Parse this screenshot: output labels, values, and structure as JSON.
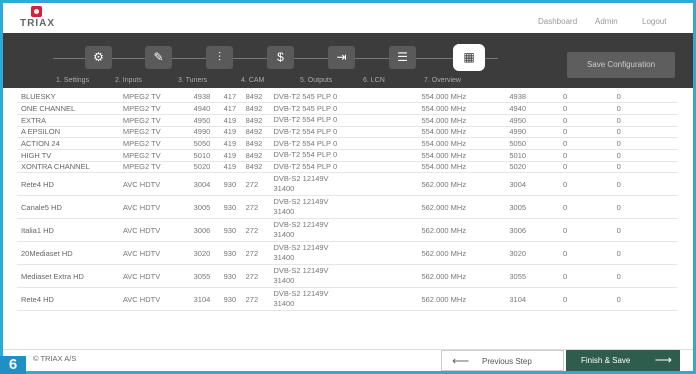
{
  "header": {
    "logo_text": "TRIAX",
    "links": [
      "Dashboard",
      "Admin",
      "Logout"
    ]
  },
  "steps": [
    {
      "label": "1. Settings",
      "icon": "gear-icon",
      "glyph": "⚙"
    },
    {
      "label": "2. Inputs",
      "icon": "plug-icon",
      "glyph": "✎"
    },
    {
      "label": "3. Tuners",
      "icon": "sliders-icon",
      "glyph": "⫶"
    },
    {
      "label": "4. CAM",
      "icon": "cam-card-icon",
      "glyph": "$"
    },
    {
      "label": "5. Outputs",
      "icon": "output-arrow-icon",
      "glyph": "⇥"
    },
    {
      "label": "6. LCN",
      "icon": "list-icon",
      "glyph": "☰"
    },
    {
      "label": "7. Overview",
      "icon": "grid-icon",
      "glyph": "▦"
    }
  ],
  "active_step": 6,
  "save_config_label": "Save Configuration",
  "table": {
    "rows": [
      [
        "BLUESKY",
        "MPEG2 TV",
        "4938",
        "417",
        "8492",
        "DVB-T2 545 PLP 0",
        "554.000 MHz",
        "4938",
        "0",
        "0"
      ],
      [
        "ONE CHANNEL",
        "MPEG2 TV",
        "4940",
        "417",
        "8492",
        "DVB-T2 545 PLP 0",
        "554.000 MHz",
        "4940",
        "0",
        "0"
      ],
      [
        "EXTRA",
        "MPEG2 TV",
        "4950",
        "419",
        "8492",
        "DVB-T2 554 PLP 0",
        "554.000 MHz",
        "4950",
        "0",
        "0"
      ],
      [
        "A EPSILON",
        "MPEG2 TV",
        "4990",
        "419",
        "8492",
        "DVB-T2 554 PLP 0",
        "554.000 MHz",
        "4990",
        "0",
        "0"
      ],
      [
        "ACTION 24",
        "MPEG2 TV",
        "5050",
        "419",
        "8492",
        "DVB-T2 554 PLP 0",
        "554.000 MHz",
        "5050",
        "0",
        "0"
      ],
      [
        "HIGH TV",
        "MPEG2 TV",
        "5010",
        "419",
        "8492",
        "DVB-T2 554 PLP 0",
        "554.000 MHz",
        "5010",
        "0",
        "0"
      ],
      [
        "XONTRA CHANNEL",
        "MPEG2 TV",
        "5020",
        "419",
        "8492",
        "DVB-T2 554 PLP 0",
        "554.000 MHz",
        "5020",
        "0",
        "0"
      ],
      [
        "Rete4 HD",
        "AVC HDTV",
        "3004",
        "930",
        "272",
        "DVB-S2 12149V\n31400",
        "562.000 MHz",
        "3004",
        "0",
        "0"
      ],
      [
        "Canale5 HD",
        "AVC HDTV",
        "3005",
        "930",
        "272",
        "DVB-S2 12149V\n31400",
        "562.000 MHz",
        "3005",
        "0",
        "0"
      ],
      [
        "Italia1 HD",
        "AVC HDTV",
        "3006",
        "930",
        "272",
        "DVB-S2 12149V\n31400",
        "562.000 MHz",
        "3006",
        "0",
        "0"
      ],
      [
        "20Mediaset HD",
        "AVC HDTV",
        "3020",
        "930",
        "272",
        "DVB-S2 12149V\n31400",
        "562.000 MHz",
        "3020",
        "0",
        "0"
      ],
      [
        "Mediaset Extra HD",
        "AVC HDTV",
        "3055",
        "930",
        "272",
        "DVB-S2 12149V\n31400",
        "562.000 MHz",
        "3055",
        "0",
        "0"
      ],
      [
        "Rete4 HD",
        "AVC HDTV",
        "3104",
        "930",
        "272",
        "DVB-S2 12149V\n31400",
        "562.000 MHz",
        "3104",
        "0",
        "0"
      ]
    ]
  },
  "footer": {
    "copyright": "© TRIAX A/S",
    "prev_label": "Previous Step",
    "finish_label": "Finish & Save",
    "prev_arrow": "⟵",
    "finish_arrow": "⟶"
  },
  "badge": "6"
}
